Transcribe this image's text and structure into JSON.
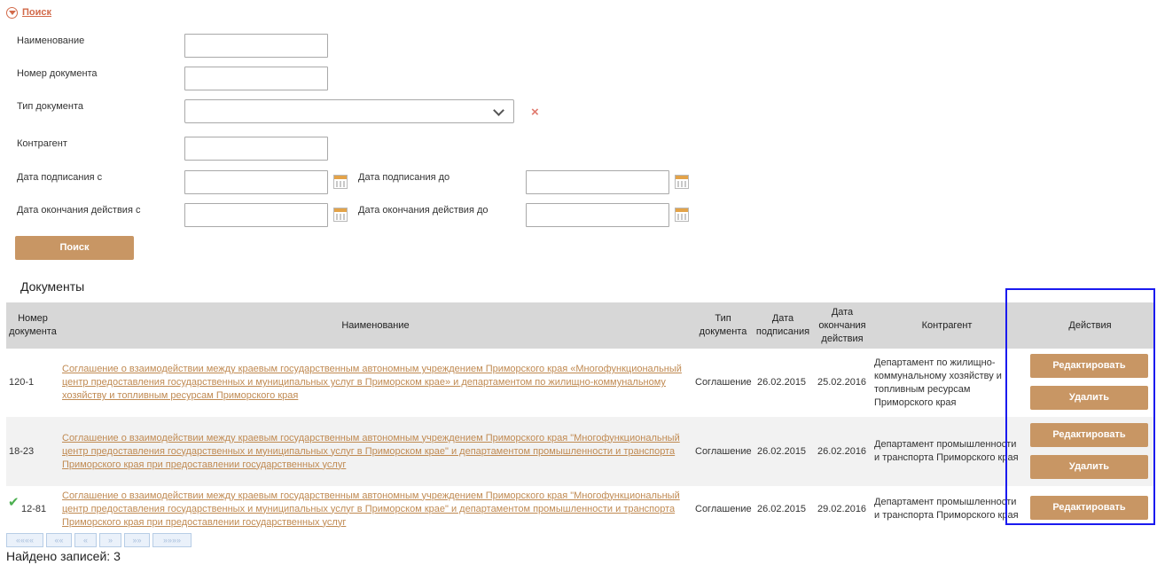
{
  "search": {
    "toggle_label": "Поиск",
    "fields": {
      "name_label": "Наименование",
      "number_label": "Номер документа",
      "type_label": "Тип документа",
      "contractor_label": "Контрагент",
      "sign_from_label": "Дата подписания с",
      "sign_to_label": "Дата подписания до",
      "end_from_label": "Дата окончания действия с",
      "end_to_label": "Дата окончания действия до"
    },
    "clear_icon": "×",
    "button_label": "Поиск"
  },
  "documents": {
    "title": "Документы",
    "headers": {
      "number": "Номер документа",
      "name": "Наименование",
      "type": "Тип документа",
      "sign_date": "Дата подписания",
      "end_date": "Дата окончания действия",
      "contractor": "Контрагент",
      "actions": "Действия"
    },
    "rows": [
      {
        "number": "120-1",
        "name": "Соглашение о взаимодействии между краевым государственным автономным учреждением Приморского края «Многофункциональный центр предоставления государственных и муниципальных услуг в Приморском крае» и департаментом по жилищно-коммунальному хозяйству и топливным ресурсам Приморского края",
        "type": "Соглашение",
        "sign_date": "26.02.2015",
        "end_date": "25.02.2016",
        "contractor": "Департамент по жилищно-коммунальному хозяйству и топливным ресурсам Приморского края",
        "edit_label": "Редактировать",
        "delete_label": "Удалить"
      },
      {
        "number": "18-23",
        "name": "Соглашение о взаимодействии между краевым государственным автономным учреждением Приморского края \"Многофункциональный центр предоставления государственных и муниципальных услуг в Приморском крае\" и департаментом промышленности и транспорта Приморского края при предоставлении государственных услуг",
        "type": "Соглашение",
        "sign_date": "26.02.2015",
        "end_date": "26.02.2016",
        "contractor": "Департамент промышленности и транспорта Приморского края",
        "edit_label": "Редактировать",
        "delete_label": "Удалить"
      },
      {
        "check": "✔",
        "number": "12-81",
        "name": "Соглашение о взаимодействии между краевым государственным автономным учреждением Приморского края \"Многофункциональный центр предоставления государственных и муниципальных услуг в Приморском крае\" и департаментом промышленности и транспорта Приморского края при предоставлении государственных услуг",
        "type": "Соглашение",
        "sign_date": "26.02.2015",
        "end_date": "29.02.2016",
        "contractor": "Департамент промышленности и транспорта Приморского края",
        "edit_label": "Редактировать"
      }
    ]
  },
  "pager": {
    "first": "««««",
    "prev_page": "««",
    "prev": "«",
    "next": "»",
    "next_page": "»»",
    "last": "»»»»"
  },
  "footer": {
    "found": "Найдено записей: 3"
  },
  "colors": {
    "accent": "#c89664",
    "link": "#c08a52",
    "header_bg": "#d7d7d7",
    "highlight_border": "#1a1aef"
  }
}
